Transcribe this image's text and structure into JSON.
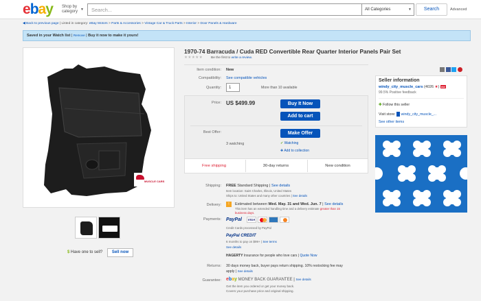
{
  "colors": {
    "accent": "#0654ba",
    "red": "#dd1e31",
    "banner": "#c3e3f7"
  },
  "header": {
    "logo": [
      "e",
      "b",
      "a",
      "y"
    ],
    "shop_by": "Shop by",
    "category": "category",
    "search_placeholder": "Search...",
    "category_select": "All Categories",
    "search_button": "Search",
    "advanced": "Advanced"
  },
  "breadcrumb": {
    "back": "Back to previous page",
    "listed_in": "Listed in category:",
    "items": [
      "eBay Motors",
      "Parts & Accessories",
      "Vintage Car & Truck Parts",
      "Interior",
      "Door Panels & Hardware"
    ]
  },
  "banner": {
    "saved": "Saved in your Watch list",
    "remove": "Remove",
    "cta": "Buy it now to make it yours!"
  },
  "product": {
    "title": "1970-74 Barracuda / Cuda RED Convertible Rear Quarter Interior Panels Pair Set",
    "review_prompt": "Be the first to",
    "review_link": "write a review.",
    "rows": {
      "condition_label": "Item condition:",
      "condition_value": "New",
      "compat_label": "Compatibility:",
      "compat_value": "See compatible vehicles",
      "qty_label": "Quantity:",
      "qty_value": "1",
      "qty_avail": "More than 10 available"
    },
    "price_label": "Price:",
    "price": "US $499.99",
    "buy_now": "Buy It Now",
    "add_to_cart": "Add to cart",
    "offer_label": "Best Offer:",
    "make_offer": "Make Offer",
    "watching": "3 watching",
    "watching_link": "Watching",
    "add_collection": "Add to collection",
    "free_shipping": "Free shipping",
    "returns_30": "30-day returns",
    "new_condition": "New condition",
    "watermark": "MUSCLE CARS",
    "have_one": "Have one to sell?",
    "sell_now": "Sell now"
  },
  "details": {
    "shipping_label": "Shipping:",
    "shipping_free": "FREE",
    "shipping_std": "Standard Shipping",
    "see_details": "See details",
    "item_location": "Item location:  Saint Charles, Illinois, United States",
    "ships_to": "Ships to:  United States and many other countries",
    "delivery_label": "Delivery:",
    "delivery_text": "Estimated between",
    "delivery_dates": "Wed. May. 31 and Wed. Jun. 7",
    "delivery_note": "This item has an extended handling time and a delivery estimate",
    "delivery_note2": "greater than 15",
    "delivery_note3": "business days.",
    "payments_label": "Payments:",
    "paypal": "PayPal",
    "visa": "VISA",
    "credit_processed": "Credit Cards processed by PayPal",
    "paypal_credit": "PayPal CREDIT",
    "paypal_credit_note": "6 months to pay on $99+",
    "see_terms": "See terms",
    "hagerty": "HAGERTY",
    "hagerty_text": "Insurance for people who love cars",
    "quote_now": "Quote Now",
    "returns_label": "Returns:",
    "returns_text": "30 days money back, buyer pays return shipping. 10% restocking fee may",
    "returns_text2": "apply",
    "guarantee_label": "Guarantee:",
    "guarantee_title": "MONEY BACK GUARANTEE",
    "guarantee_text": "Get the item you ordered or get your money back.",
    "guarantee_text2": "Covers your purchase price and original shipping."
  },
  "seller": {
    "heading": "Seller information",
    "name": "windy_city_muscle_cars",
    "score": "(4026",
    "feedback": "99.5% Positive feedback",
    "follow": "Follow this seller",
    "visit_store": "Visit store:",
    "store_name": "windy_city_muscle_...",
    "see_other": "See other items"
  }
}
